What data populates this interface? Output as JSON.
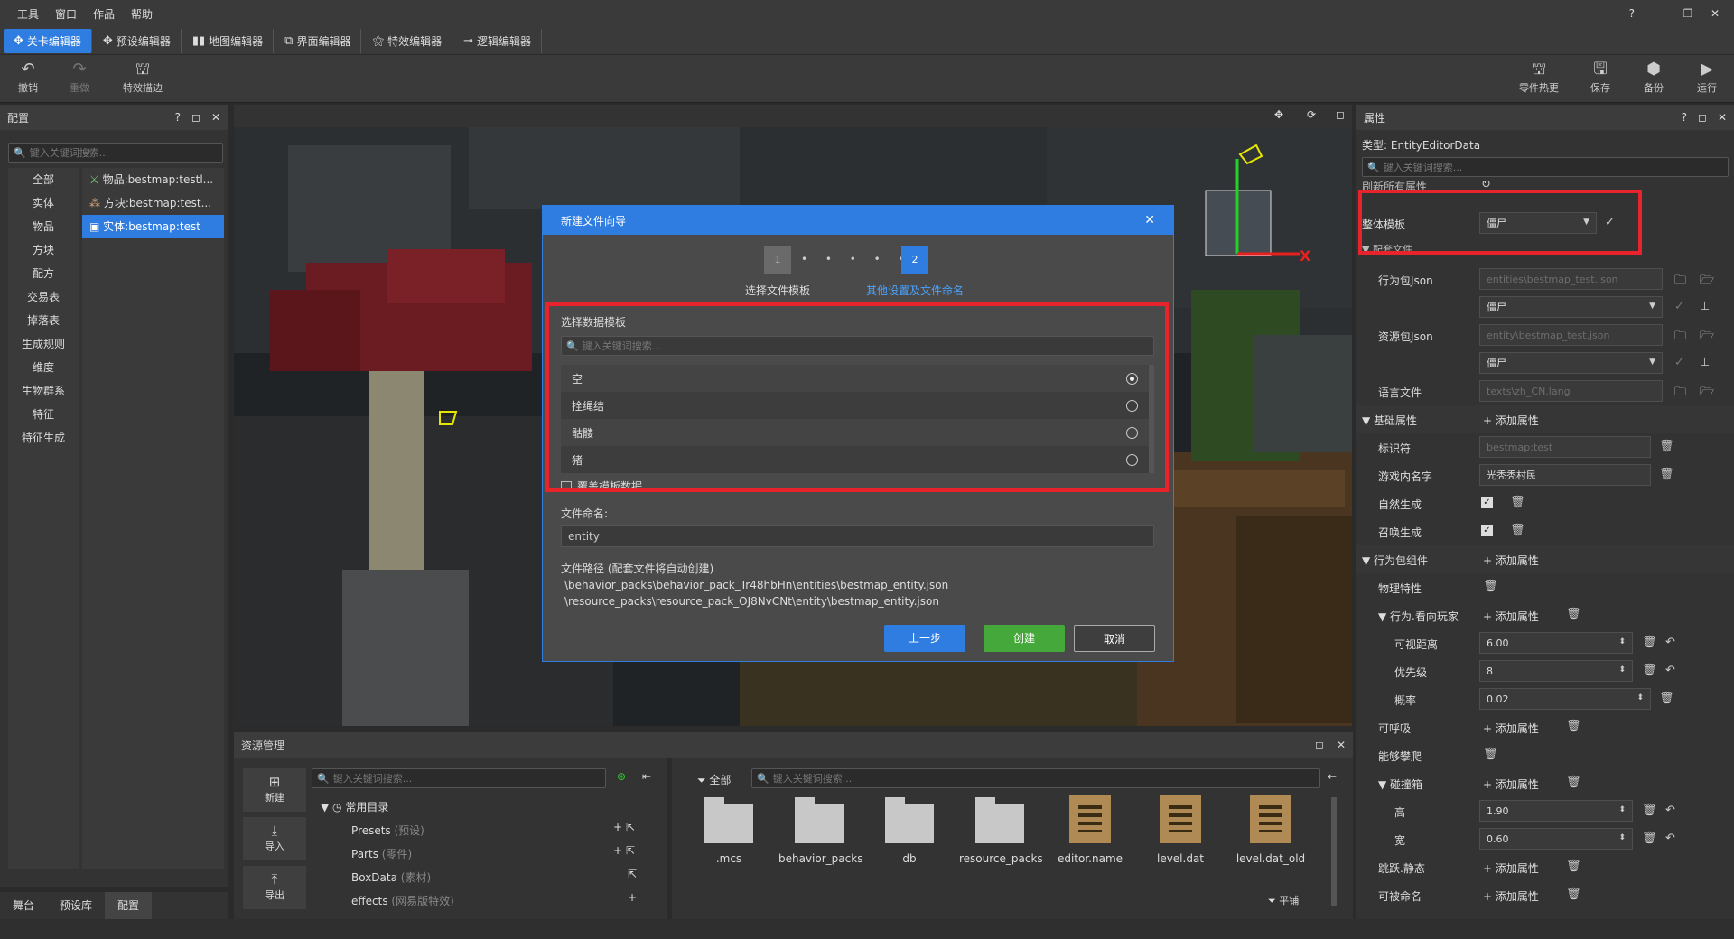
{
  "menu": [
    "工具",
    "窗口",
    "作品",
    "帮助"
  ],
  "window_buttons": [
    "?-",
    "—",
    "❐",
    "✕"
  ],
  "editor_tabs": [
    {
      "label": "关卡编辑器",
      "icon": "level-icon",
      "active": true
    },
    {
      "label": "预设编辑器",
      "icon": "preset-icon"
    },
    {
      "label": "地图编辑器",
      "icon": "map-icon"
    },
    {
      "label": "界面编辑器",
      "icon": "ui-icon"
    },
    {
      "label": "特效编辑器",
      "icon": "effect-icon"
    },
    {
      "label": "逻辑编辑器",
      "icon": "logic-icon"
    }
  ],
  "toolbar": {
    "undo": "撤销",
    "redo": "重做",
    "effect_outline": "特效描边",
    "part_hot": "零件热更",
    "save": "保存",
    "backup": "备份",
    "run": "运行"
  },
  "left_panel": {
    "title": "配置",
    "search_placeholder": "键入关键词搜索...",
    "categories": [
      "全部",
      "实体",
      "物品",
      "方块",
      "配方",
      "交易表",
      "掉落表",
      "生成规则",
      "维度",
      "生物群系",
      "特征",
      "特征生成"
    ],
    "items": [
      "物品:bestmap:testl...",
      "方块:bestmap:test...",
      "实体:bestmap:test"
    ],
    "bottom_tabs": [
      "舞台",
      "预设库",
      "配置"
    ]
  },
  "dialog": {
    "title": "新建文件向导",
    "step1": "1",
    "step2": "2",
    "step1_label": "选择文件模板",
    "step2_label": "其他设置及文件命名",
    "template_title": "选择数据模板",
    "search_placeholder": "键入关键词搜索...",
    "templates": [
      "空",
      "拴绳结",
      "骷髅",
      "猪"
    ],
    "override_label": "覆盖模板数据",
    "filename_label": "文件命名:",
    "filename_value": "entity",
    "path_label": "文件路径 (配套文件将自动创建)",
    "path1": "\\behavior_packs\\behavior_pack_Tr48hbHn\\entities\\bestmap_entity.json",
    "path2": "\\resource_packs\\resource_pack_OJ8NvCNt\\entity\\bestmap_entity.json",
    "prev": "上一步",
    "create": "创建",
    "cancel": "取消"
  },
  "props": {
    "title": "属性",
    "type_label": "类型: EntityEditorData",
    "search_placeholder": "键入关键词搜索...",
    "refresh_label": "刷新所有属性",
    "template_label": "整体模板",
    "template_value": "僵尸",
    "config_files": "配套文件",
    "behavior_json": "行为包Json",
    "behavior_path": "entities\\bestmap_test.json",
    "behavior_tpl": "僵尸",
    "resource_json": "资源包Json",
    "resource_path": "entity\\bestmap_test.json",
    "resource_tpl": "僵尸",
    "lang_file": "语言文件",
    "lang_path": "texts\\zh_CN.lang",
    "basic": "基础属性",
    "add_prop": "添加属性",
    "identifier": "标识符",
    "identifier_value": "bestmap:test",
    "ingame_name": "游戏内名字",
    "ingame_name_value": "光秃秃村民",
    "natural_spawn": "自然生成",
    "summon_spawn": "召唤生成",
    "behavior_comp": "行为包组件",
    "physics": "物理特性",
    "look_at": "行为.看向玩家",
    "view_dist": "可视距离",
    "view_dist_value": "6.00",
    "priority": "优先级",
    "priority_value": "8",
    "probability": "概率",
    "probability_value": "0.02",
    "breathable": "可呼吸",
    "climb": "能够攀爬",
    "collision": "碰撞箱",
    "height": "高",
    "height_value": "1.90",
    "width": "宽",
    "width_value": "0.60",
    "jump_static": "跳跃.静态",
    "nameable": "可被命名"
  },
  "resources": {
    "title": "资源管理",
    "search_placeholder": "键入关键词搜索...",
    "new": "新建",
    "import": "导入",
    "export": "导出",
    "common_dir": "常用目录",
    "dirs": [
      {
        "name": "Presets",
        "sub": "(预设)"
      },
      {
        "name": "Parts",
        "sub": "(零件)"
      },
      {
        "name": "BoxData",
        "sub": "(素材)"
      },
      {
        "name": "effects",
        "sub": "(网易版特效)"
      }
    ],
    "filter_all": "全部",
    "files_search_placeholder": "键入关键词搜索...",
    "files": [
      ".mcs",
      "behavior_packs",
      "db",
      "resource_packs",
      "editor.name",
      "level.dat",
      "level.dat_old"
    ],
    "tile_mode": "平铺"
  }
}
